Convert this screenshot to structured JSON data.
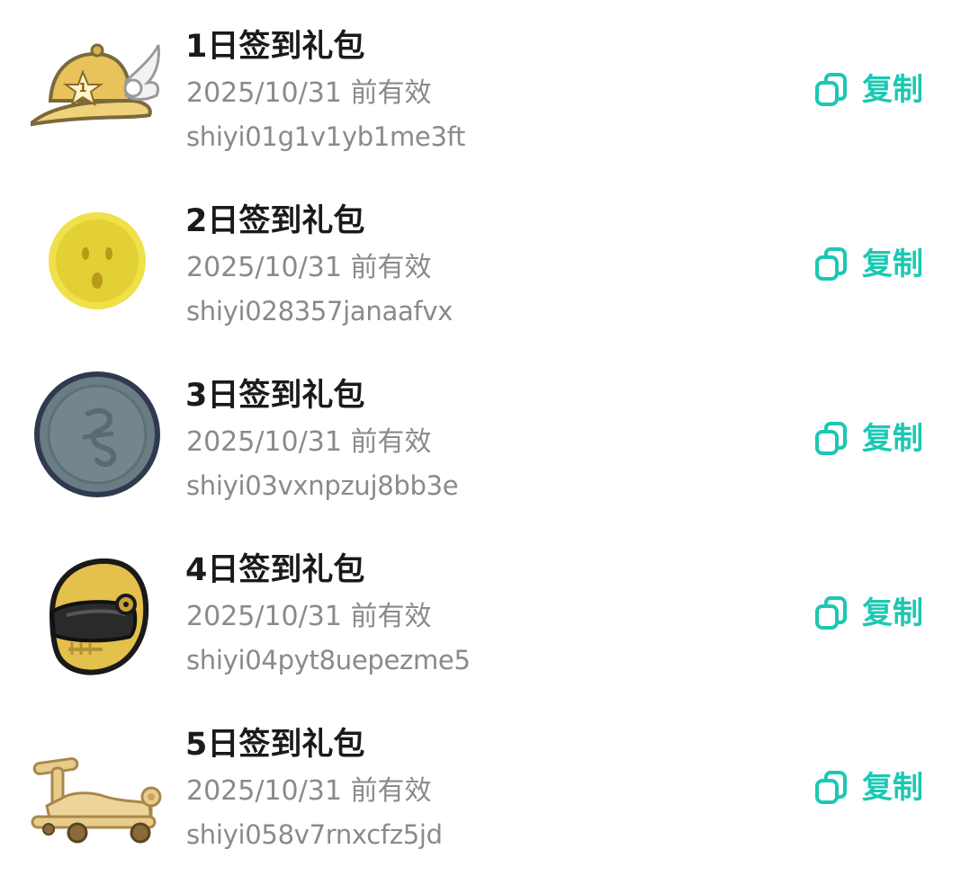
{
  "accent_color": "#1bc8b3",
  "copy_icon": "copy-icon",
  "items": [
    {
      "title": "1日签到礼包",
      "expiry": "2025/10/31 前有效",
      "code": "shiyi01g1v1yb1me3ft",
      "copy_label": "复制",
      "icon": "winged-cap-icon"
    },
    {
      "title": "2日签到礼包",
      "expiry": "2025/10/31 前有效",
      "code": "shiyi028357janaafvx",
      "copy_label": "复制",
      "icon": "gold-face-coin-icon"
    },
    {
      "title": "3日签到礼包",
      "expiry": "2025/10/31 前有效",
      "code": "shiyi03vxnpzuj8bb3e",
      "copy_label": "复制",
      "icon": "gray-coin-icon"
    },
    {
      "title": "4日签到礼包",
      "expiry": "2025/10/31 前有效",
      "code": "shiyi04pyt8uepezme5",
      "copy_label": "复制",
      "icon": "motorcycle-helmet-icon"
    },
    {
      "title": "5日签到礼包",
      "expiry": "2025/10/31 前有效",
      "code": "shiyi058v7rnxcfz5jd",
      "copy_label": "复制",
      "icon": "scooter-icon"
    }
  ]
}
